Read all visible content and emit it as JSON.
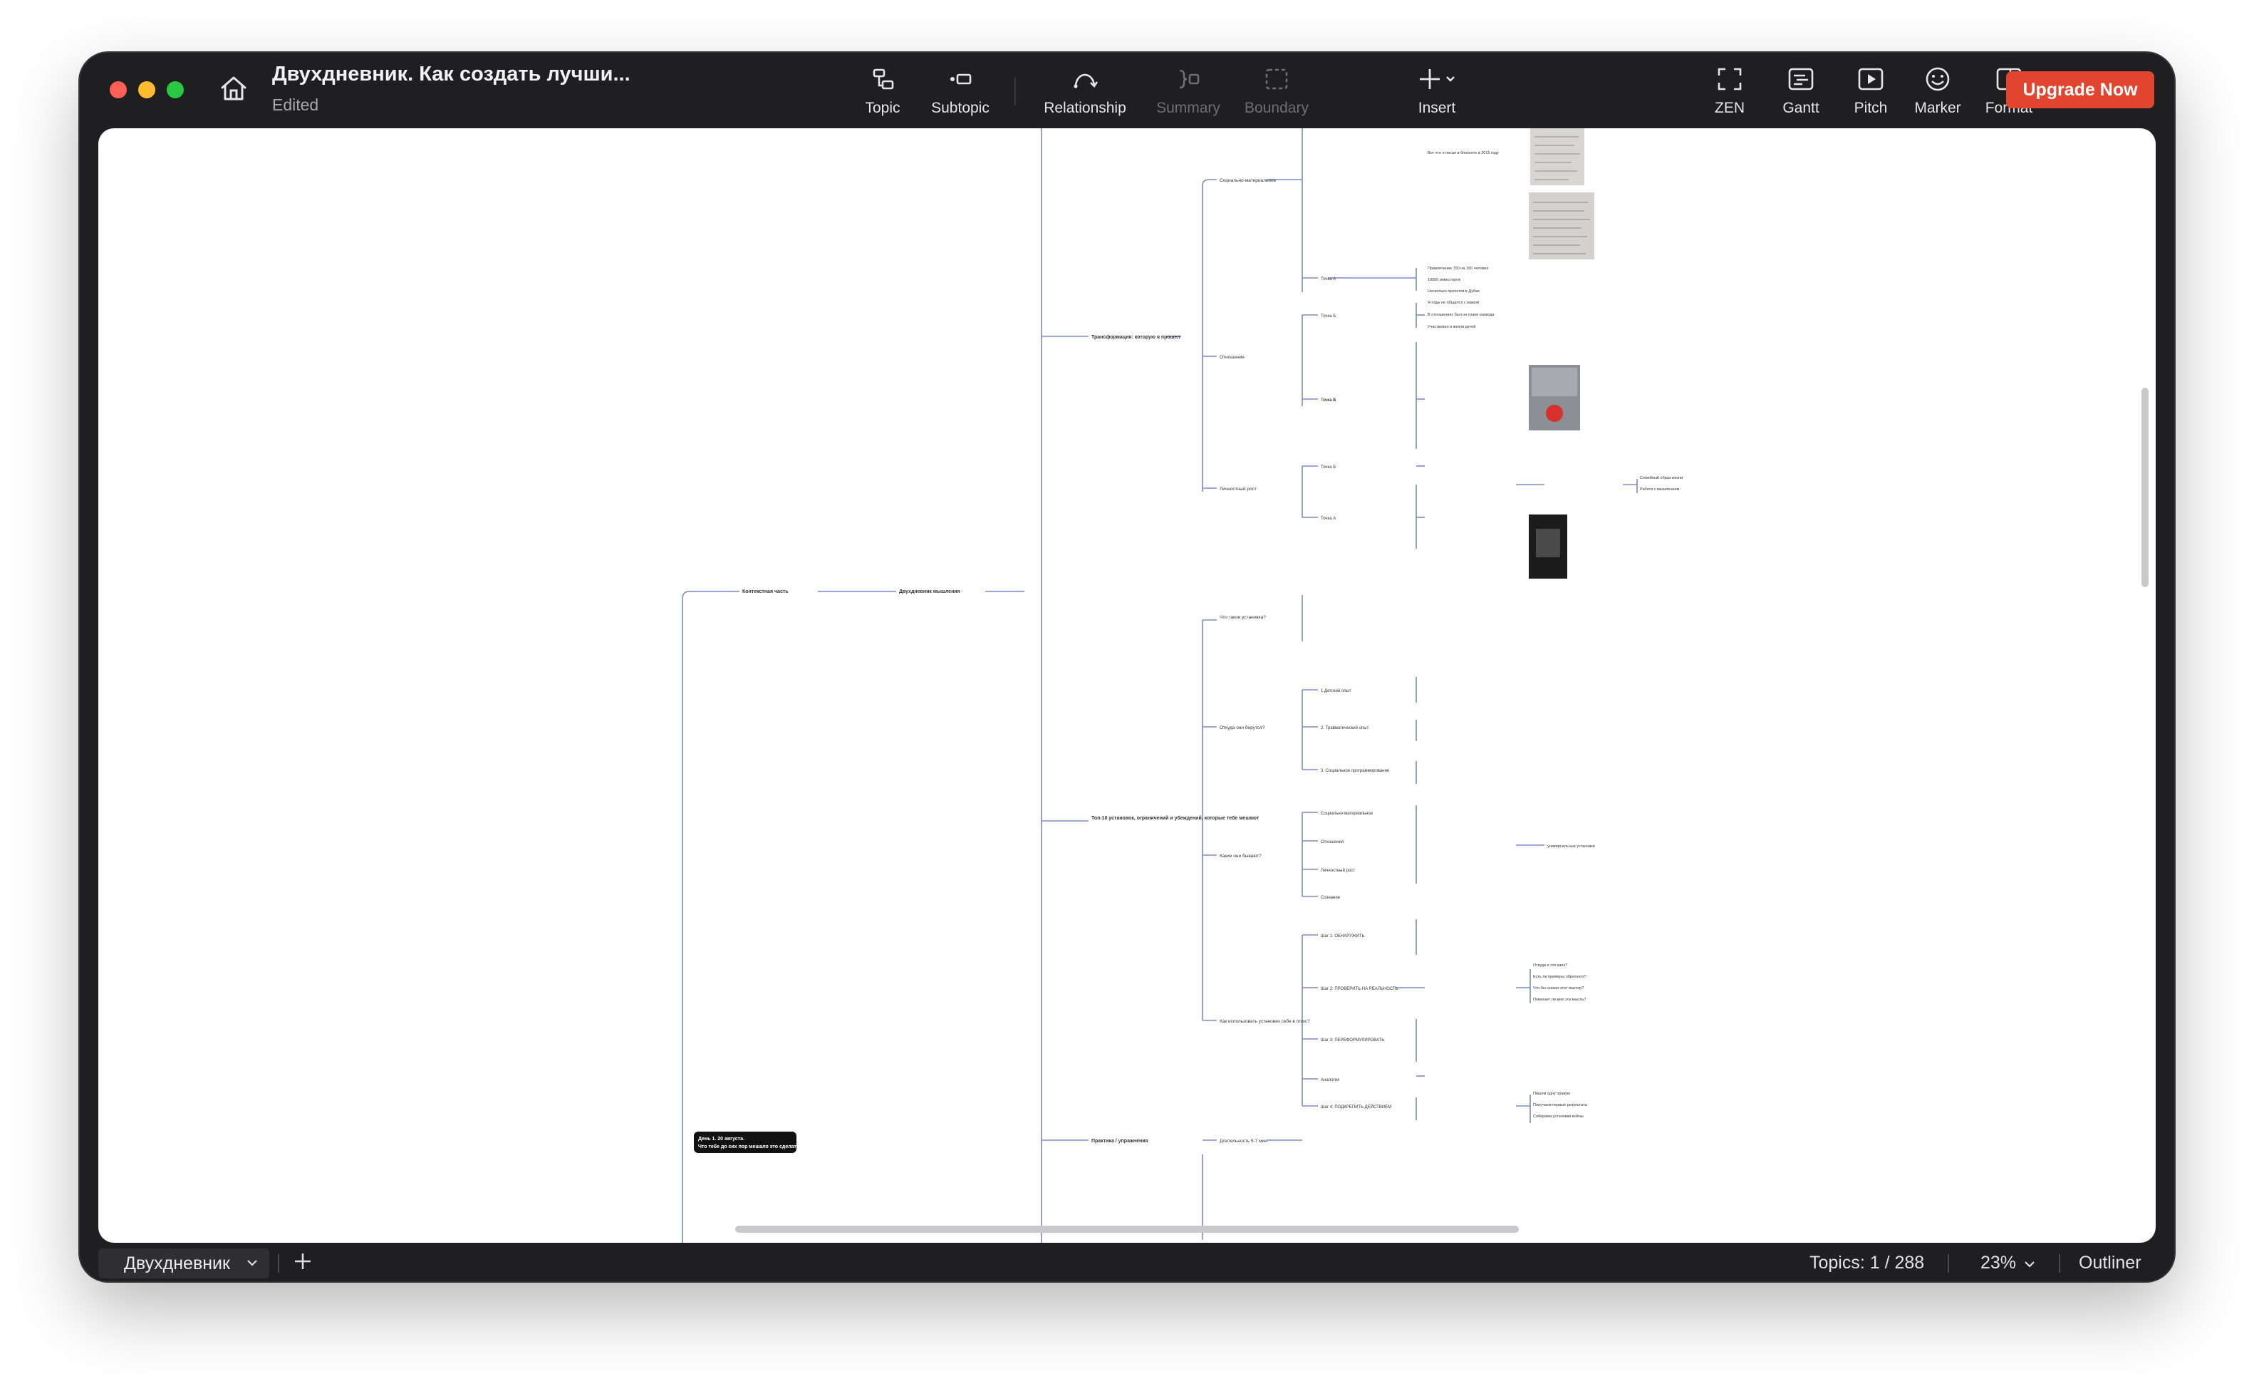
{
  "window": {
    "title": "Двухдневник. Как создать лучши...",
    "status": "Edited"
  },
  "toolbar": {
    "topic": "Topic",
    "subtopic": "Subtopic",
    "relationship": "Relationship",
    "summary": "Summary",
    "boundary": "Boundary",
    "insert": "Insert",
    "zen": "ZEN",
    "gantt": "Gantt",
    "pitch": "Pitch",
    "marker": "Marker",
    "format": "Format",
    "upgrade": "Upgrade Now"
  },
  "mindmap": {
    "central_topic": "День 1. 20 августа. Что тебе до сих пор мешало это сделать?",
    "level1": [
      "Контекстная часть"
    ],
    "level2": [
      "Двухдневник мышления"
    ],
    "level3": [
      "Трансформация: которую я прошел",
      "Топ-10 установок, ограничений и убеждений, которые тебе мешают",
      "Практика / упражнения"
    ],
    "level4": [
      "Социально-материальное",
      "Отношения",
      "Личностный рост",
      "Что такое установка?",
      "Откуда они берутся?",
      "Какие они бывают?",
      "Как использовать установки себе в плюс?",
      "Длительность 5-7 мин"
    ],
    "level5": [
      "Точка А",
      "Точка Б",
      "Точка А",
      "Точка Б",
      "Точка А",
      "Точка Б",
      "1.Детский опыт",
      "2. Травматический опыт",
      "3. Социальное программирование",
      "Социально-материальное",
      "Отношения",
      "Личностный рост",
      "Сознание",
      "Шаг 1: ОБНАРУЖИТЬ",
      "Шаг 2: ПРОВЕРИТЬ НА РЕАЛЬНОСТЬ",
      "Шаг 3: ПЕРЕФОРМУЛИРОВАТЬ",
      "Аналогия",
      "Шаг 4: ПОДКРЕПИТЬ ДЕЙСТВИЕМ"
    ],
    "level6": [
      "Вот что я писал в блокноте в 2015 году",
      "Привлечение 700 на 100 человек",
      "10000 инвесторов",
      "Несколько проектов в Дубае",
      "Я годы не общался с мамой",
      "В отношениях был на грани развода",
      "Участвовал в жизни детей"
    ],
    "side_labels": [
      "Семейный образ жизни",
      "Работа с мышлением",
      "универсальные установки",
      "Откуда я это взял?",
      "Есть ли примеры обратного?",
      "Что бы сказал этот мастер?",
      "Помогает ли мне эта мысль?",
      "Пишем одну правую",
      "Получаем первые результаты",
      "Собираем установки войны"
    ]
  },
  "bottombar": {
    "sheet_name": "Двухдневник",
    "topics_count": "Topics: 1 / 288",
    "zoom": "23%",
    "outliner": "Outliner"
  }
}
